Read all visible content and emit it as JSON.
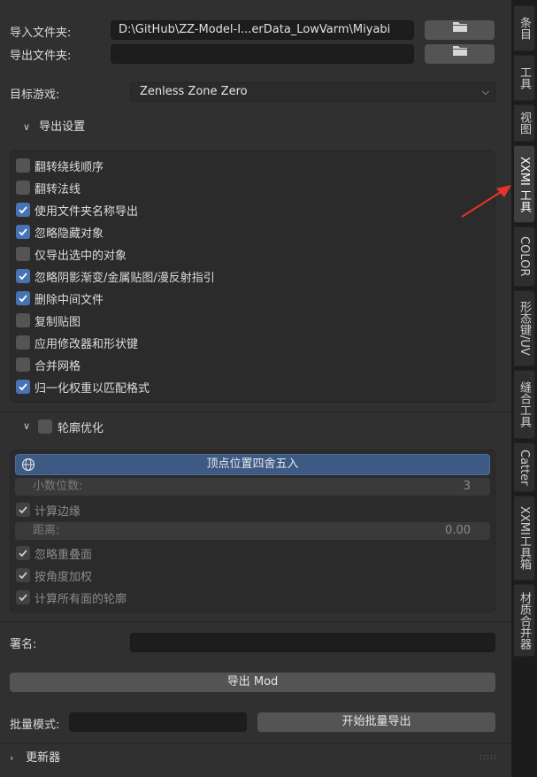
{
  "import_folder": {
    "label": "导入文件夹:",
    "value": "D:\\GitHub\\ZZ-Model-I...erData_LowVarm\\Miyabi"
  },
  "export_folder": {
    "label": "导出文件夹:",
    "value": ""
  },
  "target_game": {
    "label": "目标游戏:",
    "value": "Zenless Zone Zero"
  },
  "export_settings": {
    "title": "导出设置",
    "options": [
      {
        "label": "翻转绕线顺序",
        "checked": false
      },
      {
        "label": "翻转法线",
        "checked": false
      },
      {
        "label": "使用文件夹名称导出",
        "checked": true
      },
      {
        "label": "忽略隐藏对象",
        "checked": true
      },
      {
        "label": "仅导出选中的对象",
        "checked": false
      },
      {
        "label": "忽略阴影渐变/金属贴图/漫反射指引",
        "checked": true
      },
      {
        "label": "删除中间文件",
        "checked": true
      },
      {
        "label": "复制贴图",
        "checked": false
      },
      {
        "label": "应用修改器和形状键",
        "checked": false
      },
      {
        "label": "合并网格",
        "checked": false
      },
      {
        "label": "归一化权重以匹配格式",
        "checked": true
      }
    ]
  },
  "outline": {
    "title": "轮廓优化",
    "enabled": false,
    "round_button": "顶点位置四舍五入",
    "decimal_places": {
      "label": "小数位数:",
      "value": "3"
    },
    "calc_edges": "计算边缘",
    "distance": {
      "label": "距离:",
      "value": "0.00"
    },
    "ignore_overlap": "忽略重叠面",
    "angle_weight": "按角度加权",
    "calc_all_faces": "计算所有面的轮廓"
  },
  "signature": {
    "label": "署名:",
    "value": ""
  },
  "export_mod_button": "导出 Mod",
  "batch": {
    "label": "批量模式:",
    "value": "",
    "start_button": "开始批量导出"
  },
  "updater": {
    "title": "更新器"
  },
  "tabs": [
    "条目",
    "工具",
    "视图",
    "XXMI 工具",
    "COLOR",
    "形态键/UV",
    "缝合工具",
    "Catter",
    "XXMI工具箱",
    "材质合并器"
  ],
  "colors": {
    "accent": "#4772b3",
    "annotation_arrow": "#e8322b"
  }
}
